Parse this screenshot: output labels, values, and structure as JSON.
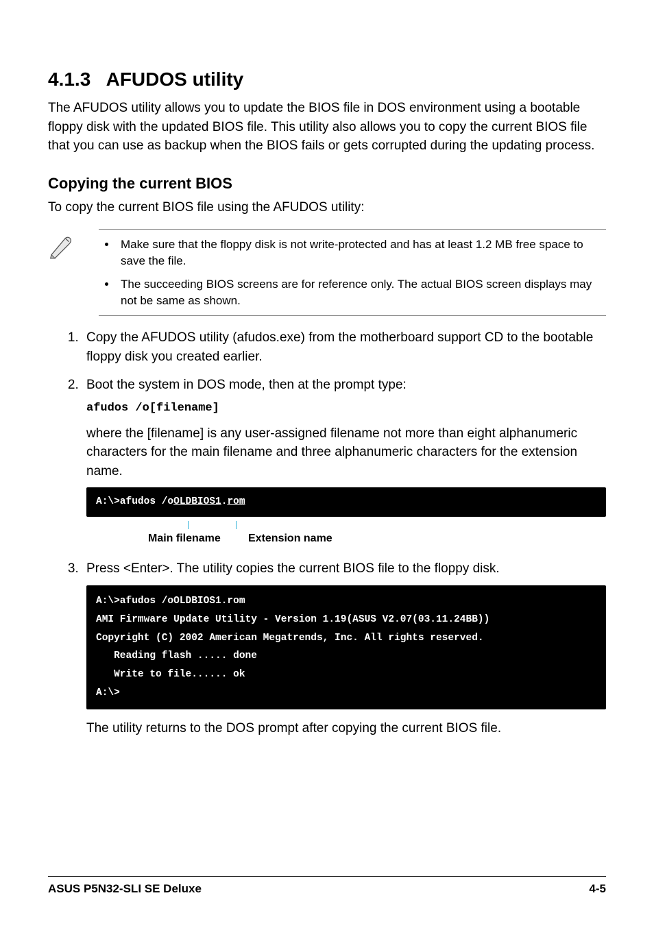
{
  "section": {
    "number": "4.1.3",
    "title": "AFUDOS utility",
    "intro": "The AFUDOS utility allows you to update the BIOS file in DOS environment using a bootable floppy disk with the updated BIOS file. This utility also allows you to copy the current BIOS file that you can use as backup when the BIOS fails or gets corrupted during the updating process."
  },
  "sub": {
    "heading": "Copying the current BIOS",
    "lead": "To copy the current BIOS file using the AFUDOS utility:"
  },
  "notes": {
    "item1": "Make sure that the floppy disk is not write-protected and has at least 1.2 MB free space to save the file.",
    "item2": "The succeeding BIOS screens are for reference only. The actual BIOS screen displays may not be same as shown."
  },
  "steps": {
    "s1": "Copy the AFUDOS utility (afudos.exe) from the motherboard support CD to the bootable floppy disk you created earlier.",
    "s2_line": "Boot the system in DOS mode, then at the prompt type:",
    "s2_cmd": "afudos /o[filename]",
    "s2_desc": "where the [filename] is any user-assigned filename not more than eight alphanumeric characters  for the main filename and three alphanumeric characters for the extension name.",
    "s3": "Press <Enter>. The utility copies the current BIOS file to the floppy disk.",
    "s3_after": "The utility returns to the DOS prompt after copying the current BIOS file."
  },
  "terminal1": {
    "prefix": "A:\\>afudos /o",
    "main": "OLDBIOS1",
    "dot": ".",
    "ext": "rom"
  },
  "labels": {
    "main": "Main filename",
    "ext": "Extension name"
  },
  "terminal2": "A:\\>afudos /oOLDBIOS1.rom\nAMI Firmware Update Utility - Version 1.19(ASUS V2.07(03.11.24BB))\nCopyright (C) 2002 American Megatrends, Inc. All rights reserved.\n   Reading flash ..... done\n   Write to file...... ok\nA:\\>",
  "footer": {
    "left": "ASUS P5N32-SLI SE Deluxe",
    "right": "4-5"
  }
}
